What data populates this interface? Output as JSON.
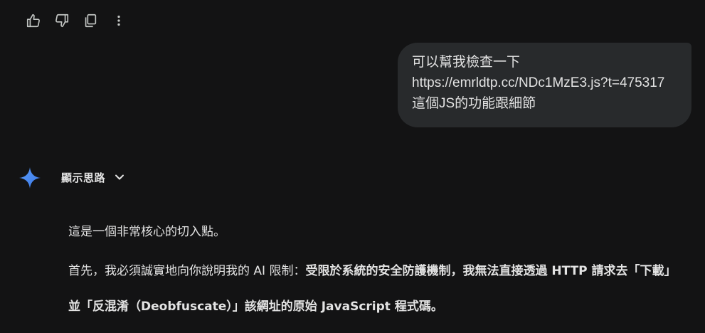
{
  "actions": {
    "icons": [
      "thumbs-up-icon",
      "thumbs-down-icon",
      "copy-icon",
      "more-vert-icon"
    ]
  },
  "user_message": {
    "line1": "可以幫我檢查一下",
    "line2": "https://emrldtp.cc/NDc1MzE3.js?t=475317",
    "line3": "這個JS的功能跟細節"
  },
  "model": {
    "thinking_label": "顯示思路",
    "paragraph1": "這是一個非常核心的切入點。",
    "paragraph2_normal": "首先，我必須誠實地向你說明我的 AI 限制：",
    "paragraph2_bold": "受限於系統的安全防護機制，我無法直接透過 HTTP 請求去「下載」並「反混淆（Deobfuscate）」該網址的原始 JavaScript 程式碼。"
  },
  "colors": {
    "background": "#131314",
    "bubble": "#282a2c",
    "text": "#e3e3e3",
    "spark_blue": "#4c8df6"
  }
}
